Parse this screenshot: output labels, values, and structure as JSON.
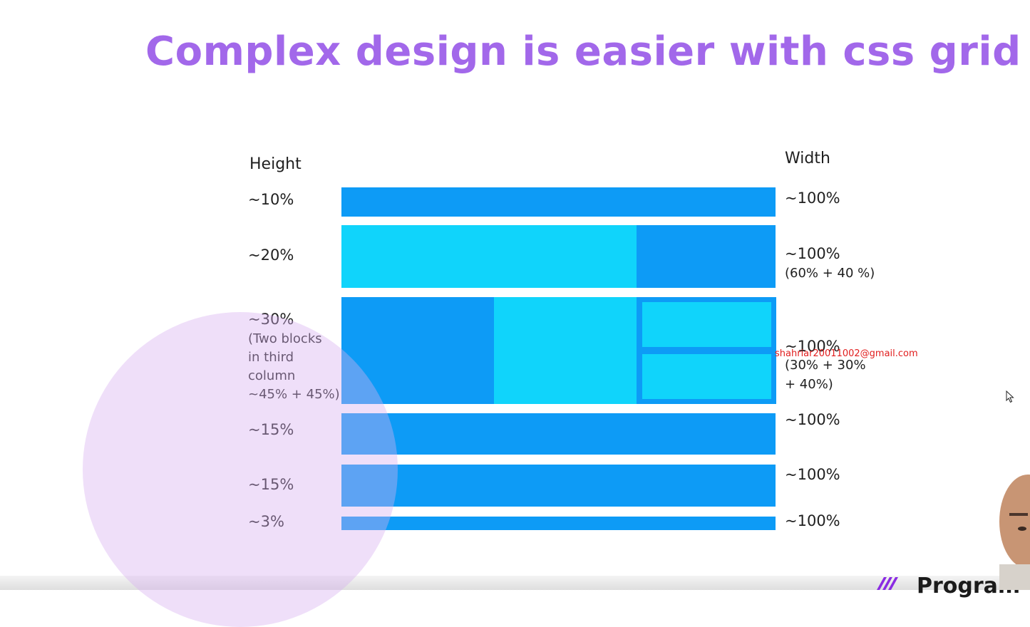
{
  "slide": {
    "title": "Complex design is easier with css grid"
  },
  "headers": {
    "height": "Height",
    "width": "Width"
  },
  "rows": [
    {
      "height": "~10%",
      "width": "~100%"
    },
    {
      "height": "~20%",
      "width": "~100%",
      "width_note": "(60% + 40 %)"
    },
    {
      "height": "~30%",
      "height_note": [
        "(Two blocks",
        "in third",
        "column",
        "~45% + 45%)"
      ],
      "width": "~100%",
      "width_note": [
        "(30% + 30%",
        "+ 40%)"
      ]
    },
    {
      "height": "~15%",
      "width": "~100%"
    },
    {
      "height": "~15%",
      "width": "~100%"
    },
    {
      "height": "~3%",
      "width": "~100%"
    }
  ],
  "overlay": {
    "email": "shahriar20011002@gmail.com"
  },
  "logo": {
    "text": "Program"
  },
  "colors": {
    "title": "#a268ea",
    "block_dark": "#0d9bf6",
    "block_light": "#10d4fb",
    "decor_circle": "#d6aef0",
    "email": "#e11d1d"
  }
}
